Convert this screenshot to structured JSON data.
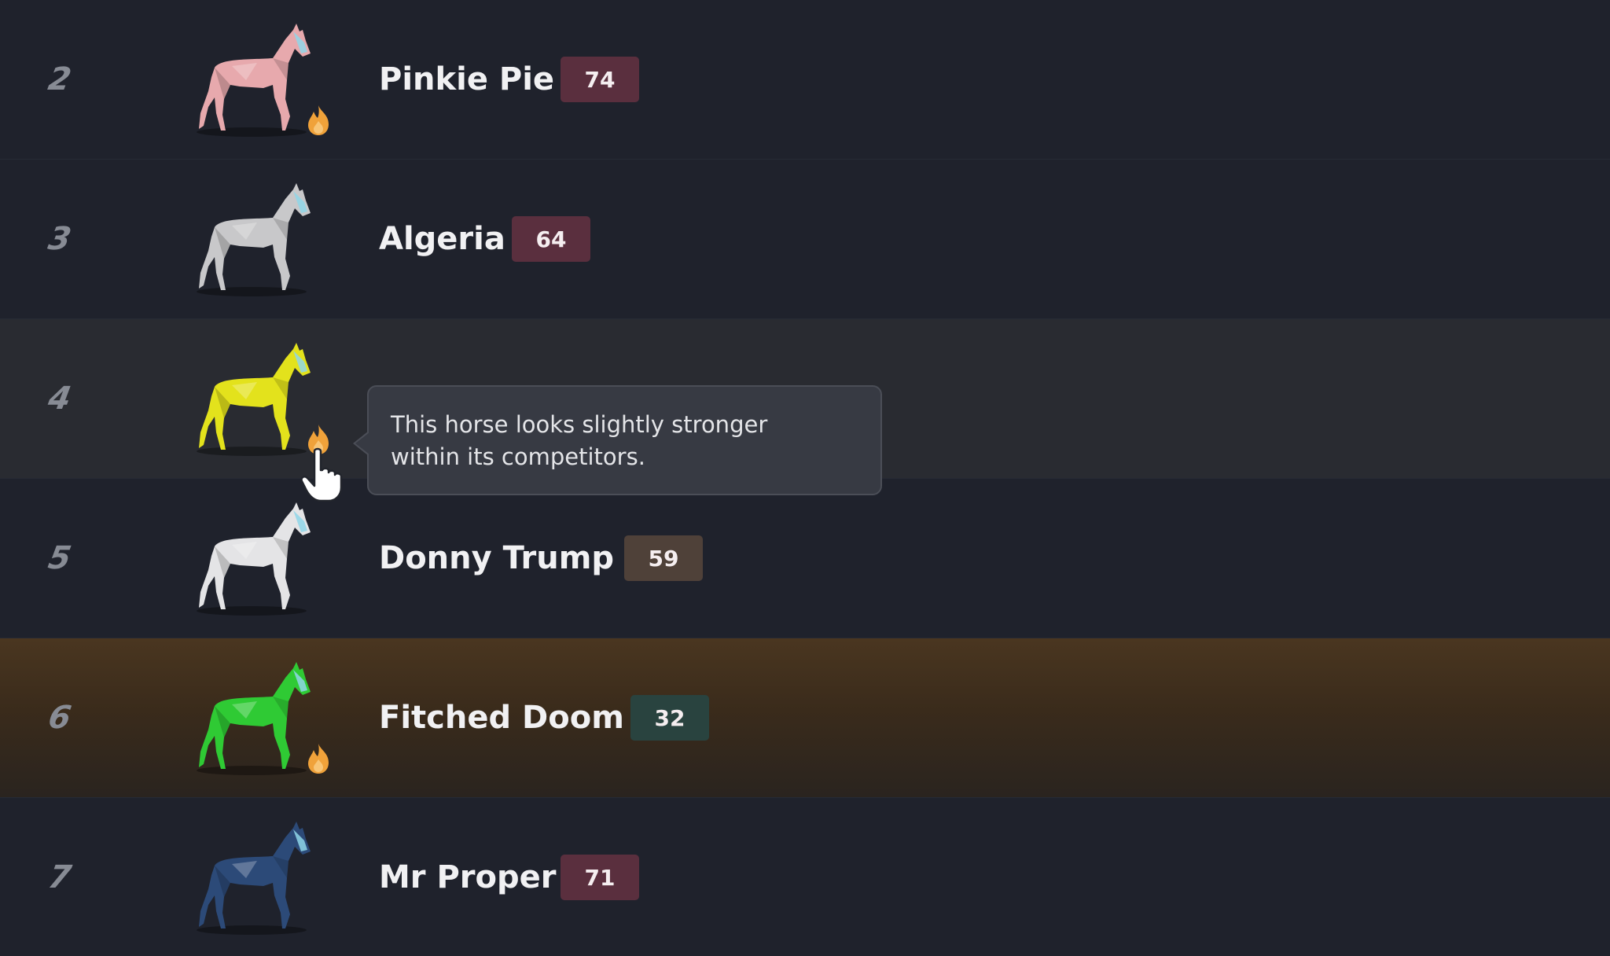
{
  "rows": [
    {
      "rank": "2",
      "name": "Pinkie Pie",
      "rating": "74",
      "coat_color": "#e7a9ad",
      "hot": true,
      "badge_color": "#5a2f3e",
      "row_style": "normal"
    },
    {
      "rank": "3",
      "name": "Algeria",
      "rating": "64",
      "coat_color": "#c8c8ca",
      "hot": false,
      "badge_color": "#5a2f3e",
      "row_style": "normal"
    },
    {
      "rank": "4",
      "name": "",
      "rating": "",
      "coat_color": "#e3e21c",
      "hot": true,
      "badge_color": "#5a2f3e",
      "row_style": "hovered"
    },
    {
      "rank": "5",
      "name": "Donny Trump",
      "rating": "59",
      "coat_color": "#e4e4e6",
      "hot": false,
      "badge_color": "#4f4139",
      "row_style": "normal"
    },
    {
      "rank": "6",
      "name": "Fitched Doom",
      "rating": "32",
      "coat_color": "#2fca34",
      "hot": true,
      "badge_color": "#29433f",
      "row_style": "highlight"
    },
    {
      "rank": "7",
      "name": "Mr Proper",
      "rating": "71",
      "coat_color": "#2c4a78",
      "hot": false,
      "badge_color": "#5a2f3e",
      "row_style": "normal"
    }
  ],
  "tooltip": {
    "line1": "This horse looks slightly stronger",
    "line2": "within its competitors."
  },
  "icons": {
    "fire": "fire-icon",
    "horse": "horse-icon",
    "cursor": "hand-pointer-icon"
  },
  "colors": {
    "background": "#1f222c",
    "highlight_row": "#4a3620",
    "fire": "#f0a23a",
    "bridle": "#8fd6e8"
  }
}
